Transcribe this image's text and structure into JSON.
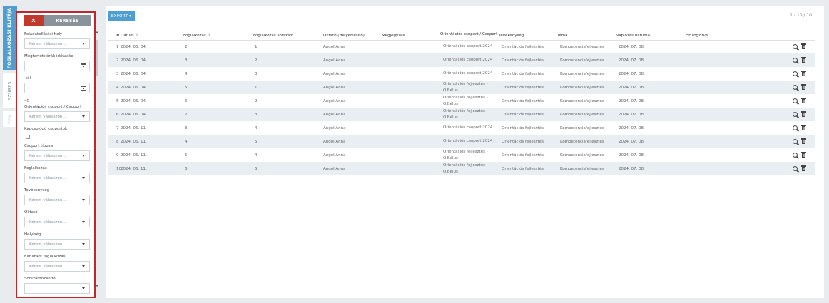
{
  "side_tabs": [
    "FOGLALKOZÁSI KLITÁJA",
    "SZÜRES",
    "TEN"
  ],
  "filter": {
    "clear_label": "X",
    "search_label": "KERESÉS",
    "placeholder": "Kérem válasszon...",
    "fields": {
      "feladatellatasi": "Feladatellátási hely",
      "megtartott": "Megtartott órák időszaka",
      "tol": "-tól",
      "ig": "-ig",
      "orientacios": "Orientációs csoport / Csoport",
      "kapcsolodo": "Kapcsolódó csoportok",
      "csoport_tipusa": "Csoport típusa",
      "foglalkozas": "Foglalkozás",
      "tevekenyseg": "Tevékenység",
      "oktato": "Oktató",
      "helyiseg": "Helyiség",
      "elmaradt": "Elmaradt foglalkozás",
      "sorszamozando": "Sorszámozandó"
    }
  },
  "toolbar": {
    "export_label": "EXPORT ▾",
    "pager": "1 - 10 / 10"
  },
  "table": {
    "headers": [
      "#",
      "Dátum",
      "Foglalkozás",
      "Foglalkozás sorszám",
      "Oktató (Helyettesítő)",
      "Megjegyzés",
      "Orientációs csoport / Csoport",
      "Tevékenység",
      "Téma",
      "Naplózás dátuma",
      "HF rögzítve"
    ],
    "sort_arrow": "↑",
    "rows": [
      [
        "1",
        "2024. 06. 04.",
        "2",
        "1",
        "Angol Anna",
        "",
        "Orientációs csoport 2024",
        "Orientációs fejlesztés",
        "Kompetenciafejlesztés",
        "2024. 07. 08."
      ],
      [
        "2",
        "2024. 06. 04.",
        "3",
        "2",
        "Angol Anna",
        "",
        "Orientációs csoport 2024",
        "Orientációs fejlesztés",
        "Kompetenciafejlesztés",
        "2024. 07. 08."
      ],
      [
        "3",
        "2024. 06. 04.",
        "4",
        "3",
        "Angol Anna",
        "",
        "Orientációs csoport 2024",
        "Orientációs fejlesztés",
        "Kompetenciafejlesztés",
        "2024. 07. 08."
      ],
      [
        "4",
        "2024. 06. 04.",
        "5",
        "1",
        "Angol Anna",
        "",
        "Orientációs fejlesztés - O.Bélus",
        "Orientációs fejlesztés",
        "Kompetenciafejlesztés",
        "2024. 07. 08."
      ],
      [
        "5",
        "2024. 06. 04.",
        "6",
        "2",
        "Angol Anna",
        "",
        "Orientációs fejlesztés - O.Bélus",
        "Orientációs fejlesztés",
        "Kompetenciafejlesztés",
        "2024. 07. 08."
      ],
      [
        "6",
        "2024. 06. 04.",
        "7",
        "3",
        "Angol Anna",
        "",
        "Orientációs fejlesztés - O.Bélus",
        "Orientációs fejlesztés",
        "Kompetenciafejlesztés",
        "2024. 07. 08."
      ],
      [
        "7",
        "2024. 06. 11.",
        "3",
        "4",
        "Angol Anna",
        "",
        "Orientációs csoport 2024",
        "Orientációs fejlesztés",
        "Kompetenciafejlesztés",
        "2024. 07. 08."
      ],
      [
        "8",
        "2024. 06. 11.",
        "4",
        "5",
        "Angol Anna",
        "",
        "Orientációs csoport 2024",
        "Orientációs fejlesztés",
        "Kompetenciafejlesztés",
        "2024. 07. 08."
      ],
      [
        "9",
        "2024. 06. 11.",
        "5",
        "4",
        "Angol Anna",
        "",
        "Orientációs fejlesztés - O.Bélus",
        "Orientációs fejlesztés",
        "Kompetenciafejlesztés",
        "2024. 07. 08."
      ],
      [
        "10",
        "2024. 06. 11.",
        "6",
        "5",
        "Angol Anna",
        "",
        "Orientációs fejlesztés - O.Bélus",
        "Orientációs fejlesztés",
        "Kompetenciafejlesztés",
        "2024. 07. 08."
      ]
    ]
  }
}
